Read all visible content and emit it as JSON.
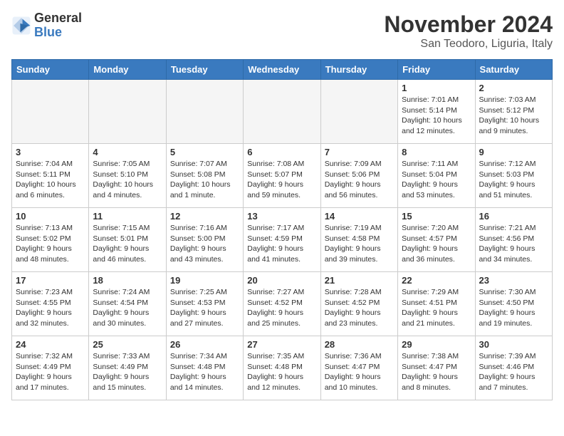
{
  "header": {
    "logo_line1": "General",
    "logo_line2": "Blue",
    "month_title": "November 2024",
    "location": "San Teodoro, Liguria, Italy"
  },
  "weekdays": [
    "Sunday",
    "Monday",
    "Tuesday",
    "Wednesday",
    "Thursday",
    "Friday",
    "Saturday"
  ],
  "weeks": [
    [
      {
        "day": "",
        "info": ""
      },
      {
        "day": "",
        "info": ""
      },
      {
        "day": "",
        "info": ""
      },
      {
        "day": "",
        "info": ""
      },
      {
        "day": "",
        "info": ""
      },
      {
        "day": "1",
        "info": "Sunrise: 7:01 AM\nSunset: 5:14 PM\nDaylight: 10 hours\nand 12 minutes."
      },
      {
        "day": "2",
        "info": "Sunrise: 7:03 AM\nSunset: 5:12 PM\nDaylight: 10 hours\nand 9 minutes."
      }
    ],
    [
      {
        "day": "3",
        "info": "Sunrise: 7:04 AM\nSunset: 5:11 PM\nDaylight: 10 hours\nand 6 minutes."
      },
      {
        "day": "4",
        "info": "Sunrise: 7:05 AM\nSunset: 5:10 PM\nDaylight: 10 hours\nand 4 minutes."
      },
      {
        "day": "5",
        "info": "Sunrise: 7:07 AM\nSunset: 5:08 PM\nDaylight: 10 hours\nand 1 minute."
      },
      {
        "day": "6",
        "info": "Sunrise: 7:08 AM\nSunset: 5:07 PM\nDaylight: 9 hours\nand 59 minutes."
      },
      {
        "day": "7",
        "info": "Sunrise: 7:09 AM\nSunset: 5:06 PM\nDaylight: 9 hours\nand 56 minutes."
      },
      {
        "day": "8",
        "info": "Sunrise: 7:11 AM\nSunset: 5:04 PM\nDaylight: 9 hours\nand 53 minutes."
      },
      {
        "day": "9",
        "info": "Sunrise: 7:12 AM\nSunset: 5:03 PM\nDaylight: 9 hours\nand 51 minutes."
      }
    ],
    [
      {
        "day": "10",
        "info": "Sunrise: 7:13 AM\nSunset: 5:02 PM\nDaylight: 9 hours\nand 48 minutes."
      },
      {
        "day": "11",
        "info": "Sunrise: 7:15 AM\nSunset: 5:01 PM\nDaylight: 9 hours\nand 46 minutes."
      },
      {
        "day": "12",
        "info": "Sunrise: 7:16 AM\nSunset: 5:00 PM\nDaylight: 9 hours\nand 43 minutes."
      },
      {
        "day": "13",
        "info": "Sunrise: 7:17 AM\nSunset: 4:59 PM\nDaylight: 9 hours\nand 41 minutes."
      },
      {
        "day": "14",
        "info": "Sunrise: 7:19 AM\nSunset: 4:58 PM\nDaylight: 9 hours\nand 39 minutes."
      },
      {
        "day": "15",
        "info": "Sunrise: 7:20 AM\nSunset: 4:57 PM\nDaylight: 9 hours\nand 36 minutes."
      },
      {
        "day": "16",
        "info": "Sunrise: 7:21 AM\nSunset: 4:56 PM\nDaylight: 9 hours\nand 34 minutes."
      }
    ],
    [
      {
        "day": "17",
        "info": "Sunrise: 7:23 AM\nSunset: 4:55 PM\nDaylight: 9 hours\nand 32 minutes."
      },
      {
        "day": "18",
        "info": "Sunrise: 7:24 AM\nSunset: 4:54 PM\nDaylight: 9 hours\nand 30 minutes."
      },
      {
        "day": "19",
        "info": "Sunrise: 7:25 AM\nSunset: 4:53 PM\nDaylight: 9 hours\nand 27 minutes."
      },
      {
        "day": "20",
        "info": "Sunrise: 7:27 AM\nSunset: 4:52 PM\nDaylight: 9 hours\nand 25 minutes."
      },
      {
        "day": "21",
        "info": "Sunrise: 7:28 AM\nSunset: 4:52 PM\nDaylight: 9 hours\nand 23 minutes."
      },
      {
        "day": "22",
        "info": "Sunrise: 7:29 AM\nSunset: 4:51 PM\nDaylight: 9 hours\nand 21 minutes."
      },
      {
        "day": "23",
        "info": "Sunrise: 7:30 AM\nSunset: 4:50 PM\nDaylight: 9 hours\nand 19 minutes."
      }
    ],
    [
      {
        "day": "24",
        "info": "Sunrise: 7:32 AM\nSunset: 4:49 PM\nDaylight: 9 hours\nand 17 minutes."
      },
      {
        "day": "25",
        "info": "Sunrise: 7:33 AM\nSunset: 4:49 PM\nDaylight: 9 hours\nand 15 minutes."
      },
      {
        "day": "26",
        "info": "Sunrise: 7:34 AM\nSunset: 4:48 PM\nDaylight: 9 hours\nand 14 minutes."
      },
      {
        "day": "27",
        "info": "Sunrise: 7:35 AM\nSunset: 4:48 PM\nDaylight: 9 hours\nand 12 minutes."
      },
      {
        "day": "28",
        "info": "Sunrise: 7:36 AM\nSunset: 4:47 PM\nDaylight: 9 hours\nand 10 minutes."
      },
      {
        "day": "29",
        "info": "Sunrise: 7:38 AM\nSunset: 4:47 PM\nDaylight: 9 hours\nand 8 minutes."
      },
      {
        "day": "30",
        "info": "Sunrise: 7:39 AM\nSunset: 4:46 PM\nDaylight: 9 hours\nand 7 minutes."
      }
    ]
  ]
}
